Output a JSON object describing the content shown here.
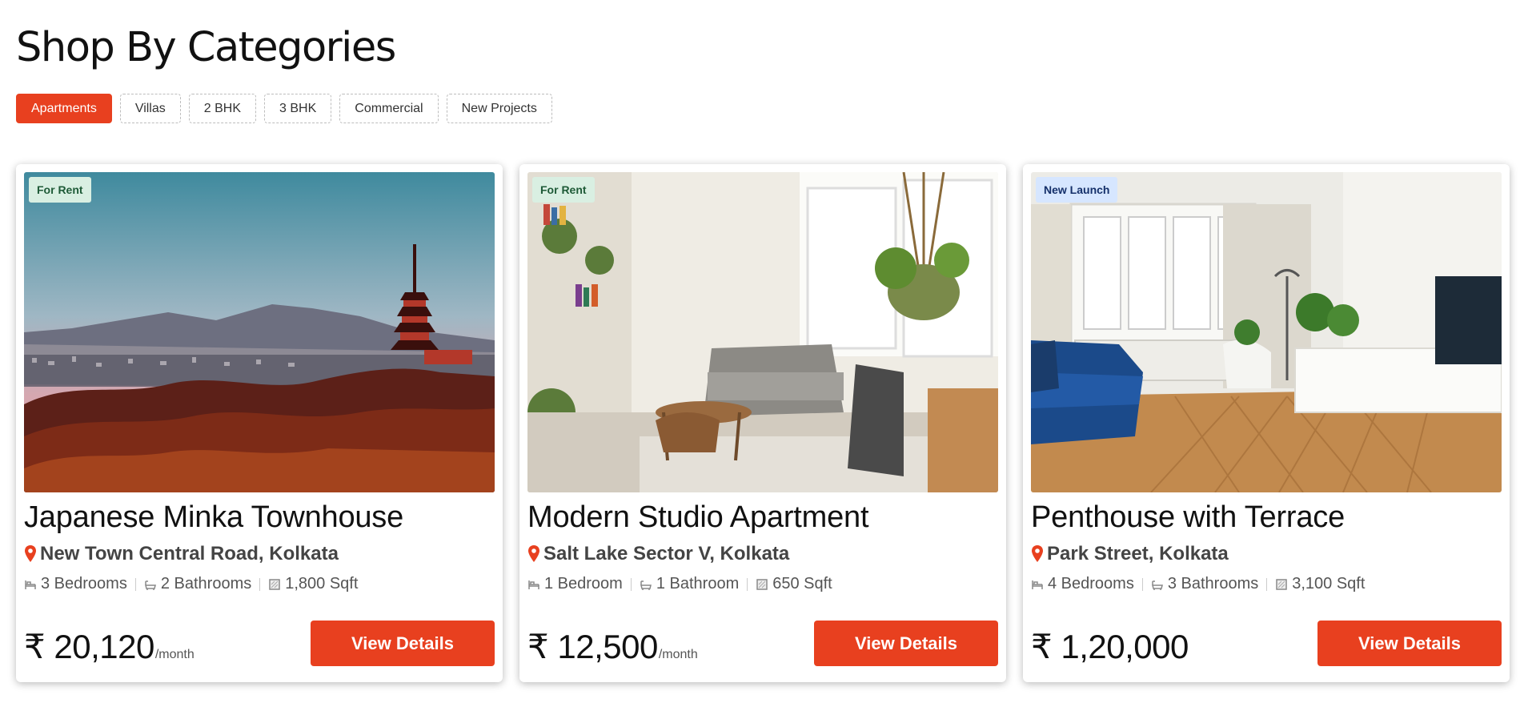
{
  "page": {
    "title": "Shop By Categories"
  },
  "tabs": [
    {
      "label": "Apartments",
      "active": true
    },
    {
      "label": "Villas",
      "active": false
    },
    {
      "label": "2 BHK",
      "active": false
    },
    {
      "label": "3 BHK",
      "active": false
    },
    {
      "label": "Commercial",
      "active": false
    },
    {
      "label": "New Projects",
      "active": false
    }
  ],
  "listings": [
    {
      "badge": "For Rent",
      "title": "Japanese Minka Townhouse",
      "location": "New Town Central Road, Kolkata",
      "bedrooms": "3 Bedrooms",
      "bathrooms": "2 Bathrooms",
      "area": "1,800 Sqft",
      "price": "₹ 20,120",
      "price_unit": "/month",
      "button": "View Details"
    },
    {
      "badge": "For Rent",
      "title": "Modern Studio Apartment",
      "location": "Salt Lake Sector V, Kolkata",
      "bedrooms": "1 Bedroom",
      "bathrooms": "1 Bathroom",
      "area": "650 Sqft",
      "price": "₹ 12,500",
      "price_unit": "/month",
      "button": "View Details"
    },
    {
      "badge": "New Launch",
      "title": "Penthouse with Terrace",
      "location": "Park Street, Kolkata",
      "bedrooms": "4 Bedrooms",
      "bathrooms": "3 Bathrooms",
      "area": "3,100 Sqft",
      "price": "₹ 1,20,000",
      "price_unit": "",
      "button": "View Details"
    }
  ],
  "colors": {
    "accent": "#e8401f",
    "rent_badge_bg": "#d9efe2",
    "launch_badge_bg": "#d6e6ff"
  },
  "icons": {
    "location": "map-pin-icon",
    "bedrooms": "bed-icon",
    "bathrooms": "bathtub-icon",
    "area": "area-icon"
  }
}
